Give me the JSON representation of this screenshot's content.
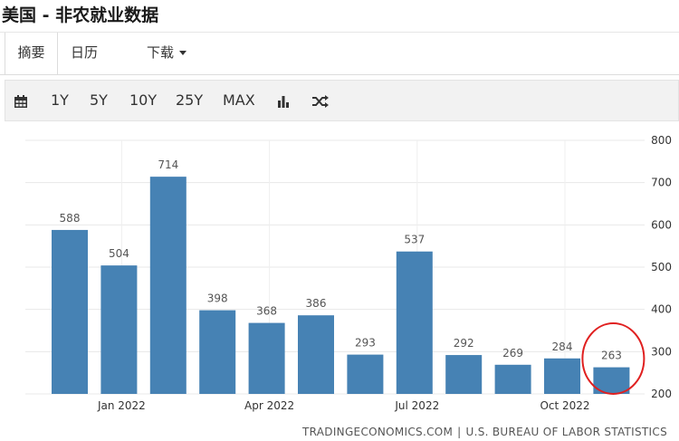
{
  "page": {
    "title": "美国 - 非农就业数据"
  },
  "tabs": [
    {
      "label": "摘要"
    },
    {
      "label": "日历"
    },
    {
      "label": "下载"
    }
  ],
  "toolbar": {
    "ranges": [
      "1Y",
      "5Y",
      "10Y",
      "25Y",
      "MAX"
    ],
    "icons": [
      "calendar-icon",
      "bar-chart-icon",
      "shuffle-icon"
    ]
  },
  "chart_data": {
    "type": "bar",
    "categories": [
      "2021-12",
      "2022-01",
      "2022-02",
      "2022-03",
      "2022-04",
      "2022-05",
      "2022-06",
      "2022-07",
      "2022-08",
      "2022-09",
      "2022-10",
      "2022-11"
    ],
    "values": [
      588,
      504,
      714,
      398,
      368,
      386,
      293,
      537,
      292,
      269,
      284,
      263
    ],
    "data_labels": [
      "588",
      "504",
      "714",
      "398",
      "368",
      "386",
      "293",
      "537",
      "292",
      "269",
      "284",
      "263"
    ],
    "x_tick_labels": [
      "Jan 2022",
      "Apr 2022",
      "Jul 2022",
      "Oct 2022"
    ],
    "y_ticks": [
      "200",
      "300",
      "400",
      "500",
      "600",
      "700",
      "800"
    ],
    "ylim": [
      200,
      800
    ],
    "y_axis_side": "right",
    "bar_color": "#4682b4",
    "highlight": {
      "index": 11,
      "shape": "circle",
      "color": "#e02020"
    },
    "title": "",
    "xlabel": "",
    "ylabel": ""
  },
  "footer": {
    "source_left": "TRADINGECONOMICS.COM",
    "separator": "|",
    "source_right": "U.S. BUREAU OF LABOR STATISTICS"
  }
}
